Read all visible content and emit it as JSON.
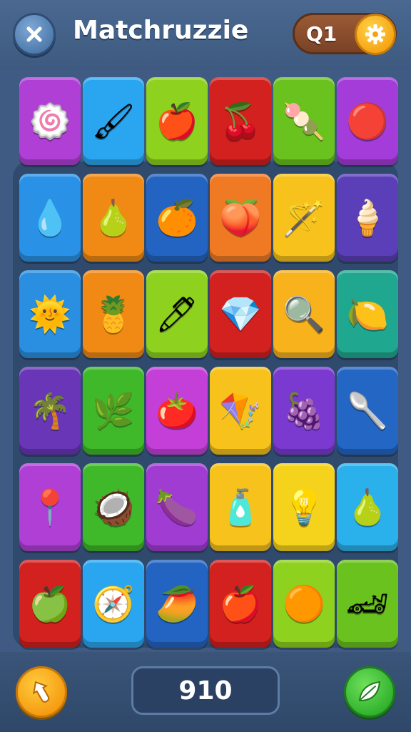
{
  "header": {
    "title": "Matchruzzie",
    "level": "Q1",
    "close_icon": "close-icon",
    "settings_icon": "gear-icon"
  },
  "board": {
    "rows": [
      [
        {
          "name": "swirl-candy",
          "glyph": "🍥",
          "color": "#b03fd6"
        },
        {
          "name": "paintbrush-leaf",
          "glyph": "🖌",
          "color": "#2aa6f0"
        },
        {
          "name": "red-apple",
          "glyph": "🍎",
          "color": "#8ed11e"
        },
        {
          "name": "cherry",
          "glyph": "🍒",
          "color": "#d2211f"
        },
        {
          "name": "lollipop-stick",
          "glyph": "🍡",
          "color": "#6ac21e"
        },
        {
          "name": "ring-gem",
          "glyph": "🔴",
          "color": "#a33cd8"
        }
      ],
      [
        {
          "name": "water-drop",
          "glyph": "💧",
          "color": "#2a92e6"
        },
        {
          "name": "pear-face",
          "glyph": "🍐",
          "color": "#f08a14"
        },
        {
          "name": "orange",
          "glyph": "🍊",
          "color": "#2364c2"
        },
        {
          "name": "plum",
          "glyph": "🍑",
          "color": "#f07a24"
        },
        {
          "name": "magic-wand",
          "glyph": "🪄",
          "color": "#f7c21c"
        },
        {
          "name": "ice-cream",
          "glyph": "🍦",
          "color": "#5a3fb8"
        }
      ],
      [
        {
          "name": "sun-face",
          "glyph": "🌞",
          "color": "#2a8fe0"
        },
        {
          "name": "pineapple-face",
          "glyph": "🍍",
          "color": "#f08a14"
        },
        {
          "name": "pen",
          "glyph": "🖊",
          "color": "#8ed11e"
        },
        {
          "name": "crystal",
          "glyph": "💎",
          "color": "#d2211f"
        },
        {
          "name": "magnifier",
          "glyph": "🔍",
          "color": "#f7b21c"
        },
        {
          "name": "lemon",
          "glyph": "🍋",
          "color": "#1fa88f"
        }
      ],
      [
        {
          "name": "palm-tree",
          "glyph": "🌴",
          "color": "#6a36b8"
        },
        {
          "name": "green-leaf",
          "glyph": "🌿",
          "color": "#3fb82a"
        },
        {
          "name": "tomato",
          "glyph": "🍅",
          "color": "#c43fd8"
        },
        {
          "name": "shovel",
          "glyph": "🪁",
          "color": "#f7c21c"
        },
        {
          "name": "grape-blob",
          "glyph": "🍇",
          "color": "#7a3ad0"
        },
        {
          "name": "maraca",
          "glyph": "🥄",
          "color": "#2466c4"
        }
      ],
      [
        {
          "name": "map-pin",
          "glyph": "📍",
          "color": "#b03fd6"
        },
        {
          "name": "coconut-face",
          "glyph": "🥥",
          "color": "#3fb82a"
        },
        {
          "name": "eggplant",
          "glyph": "🍆",
          "color": "#a03cd2"
        },
        {
          "name": "paint-tube",
          "glyph": "🧴",
          "color": "#f7c21c"
        },
        {
          "name": "light-bulb",
          "glyph": "💡",
          "color": "#f5d21c"
        },
        {
          "name": "pear-smile",
          "glyph": "🍐",
          "color": "#2ab0ea"
        }
      ],
      [
        {
          "name": "apple-slice",
          "glyph": "🍏",
          "color": "#d2211f"
        },
        {
          "name": "compass",
          "glyph": "🧭",
          "color": "#2aa6f0"
        },
        {
          "name": "mango",
          "glyph": "🥭",
          "color": "#2364c2"
        },
        {
          "name": "apple",
          "glyph": "🍎",
          "color": "#d2211f"
        },
        {
          "name": "jelly-blob",
          "glyph": "🟠",
          "color": "#8ed11e"
        },
        {
          "name": "toy-car",
          "glyph": "🏎",
          "color": "#6ac21e"
        }
      ]
    ]
  },
  "footer": {
    "score": "910",
    "hint_icon": "pointer-hand-icon",
    "shuffle_icon": "leaf-icon"
  }
}
